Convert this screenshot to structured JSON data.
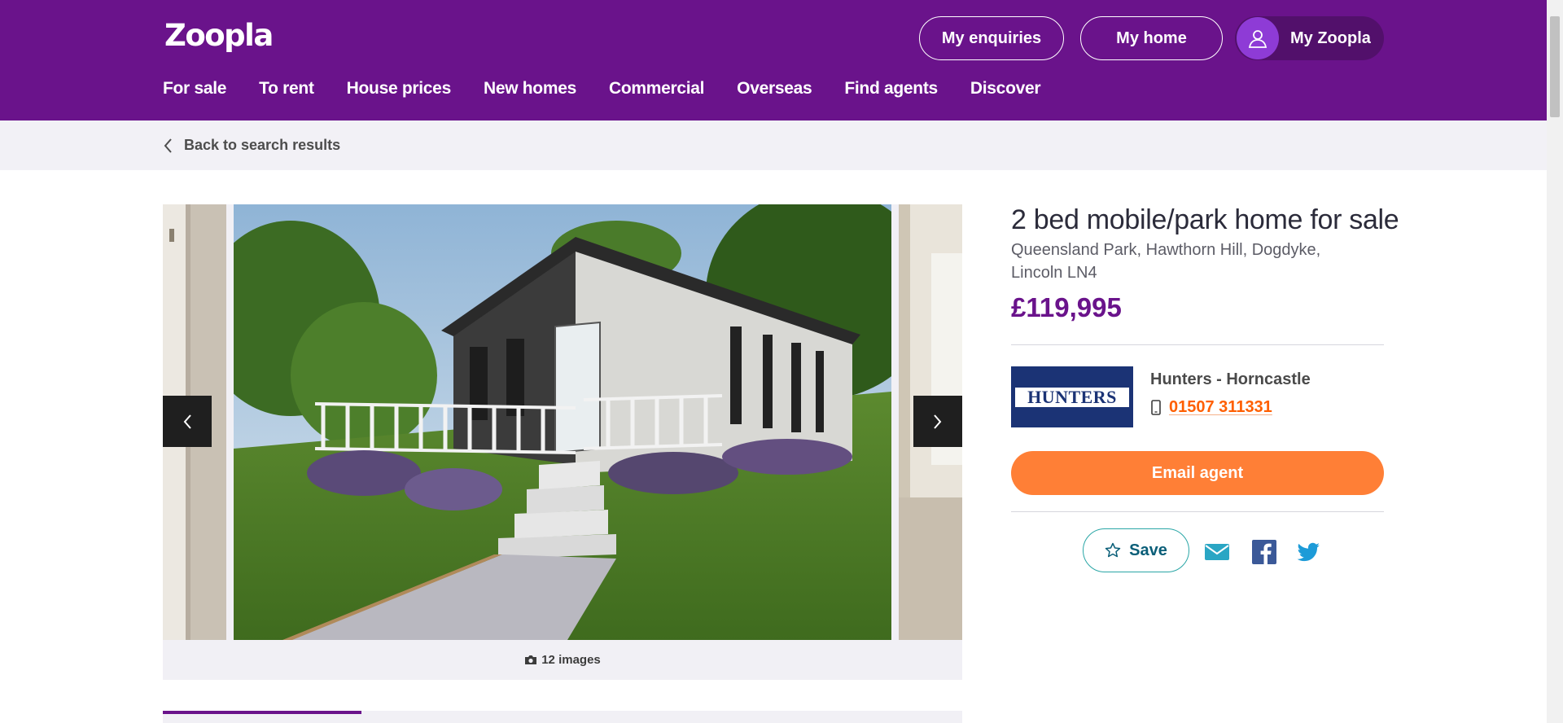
{
  "header": {
    "logo": "Zoopla",
    "my_enquiries": "My enquiries",
    "my_home": "My home",
    "my_zoopla": "My Zoopla",
    "nav": [
      "For sale",
      "To rent",
      "House prices",
      "New homes",
      "Commercial",
      "Overseas",
      "Find agents",
      "Discover"
    ]
  },
  "breadcrumb": {
    "back": "Back to search results"
  },
  "gallery": {
    "image_count": "12 images",
    "current_index": 1
  },
  "listing": {
    "title": "2 bed mobile/park home for sale",
    "address": "Queensland Park, Hawthorn Hill, Dogdyke, Lincoln LN4",
    "price": "£119,995"
  },
  "agent": {
    "logo_text": "HUNTERS",
    "name": "Hunters - Horncastle",
    "phone": "01507 311331",
    "email_button": "Email agent"
  },
  "actions": {
    "save": "Save"
  },
  "colors": {
    "brand_purple": "#6a138b",
    "cta_orange": "#ff7f36",
    "phone_orange": "#ff5f00",
    "save_teal": "#2aa6a6"
  }
}
